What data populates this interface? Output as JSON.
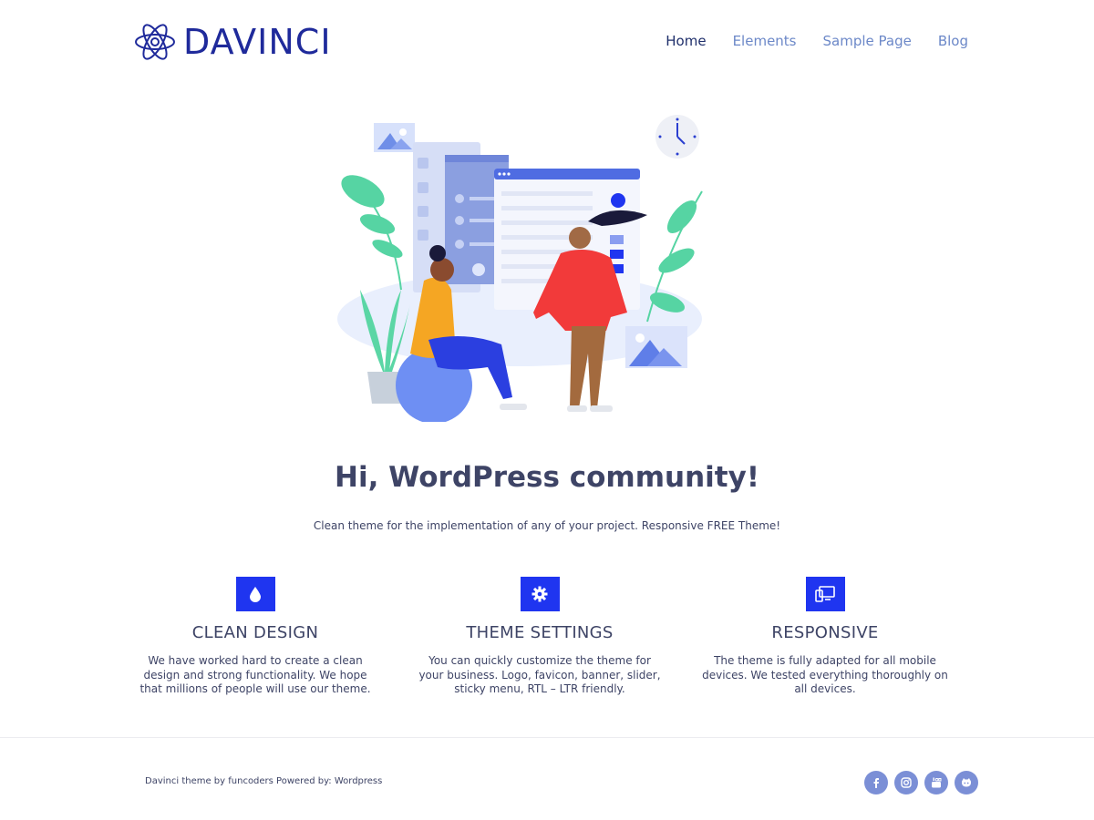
{
  "brand": {
    "name": "DAVINCI",
    "logo_icon": "atom-icon",
    "color": "#1f2a9b"
  },
  "nav": {
    "items": [
      {
        "label": "Home",
        "active": true
      },
      {
        "label": "Elements",
        "active": false
      },
      {
        "label": "Sample Page",
        "active": false
      },
      {
        "label": "Blog",
        "active": false
      }
    ]
  },
  "hero": {
    "title": "Hi, WordPress community!",
    "subtitle": "Clean theme for the implementation of any of your project. Responsive FREE Theme!"
  },
  "features": [
    {
      "icon": "drop-icon",
      "title": "CLEAN DESIGN",
      "text": "We have worked hard to create a clean design and strong functionality. We hope that millions of people will use our theme."
    },
    {
      "icon": "gear-icon",
      "title": "THEME SETTINGS",
      "text": "You can quickly customize the theme for your business. Logo, favicon, banner, slider, sticky menu, RTL – LTR friendly."
    },
    {
      "icon": "devices-icon",
      "title": "RESPONSIVE",
      "text": "The theme is fully adapted for all mobile devices. We tested everything thoroughly on all devices."
    }
  ],
  "footer": {
    "credit": "Davinci theme by funcoders Powered by: Wordpress",
    "socials": [
      "facebook-icon",
      "instagram-icon",
      "youtube-icon",
      "github-icon"
    ]
  },
  "colors": {
    "accent": "#1f35f0",
    "text": "#3e4466",
    "nav": "#6c88c8",
    "social": "#7b8fd6"
  }
}
